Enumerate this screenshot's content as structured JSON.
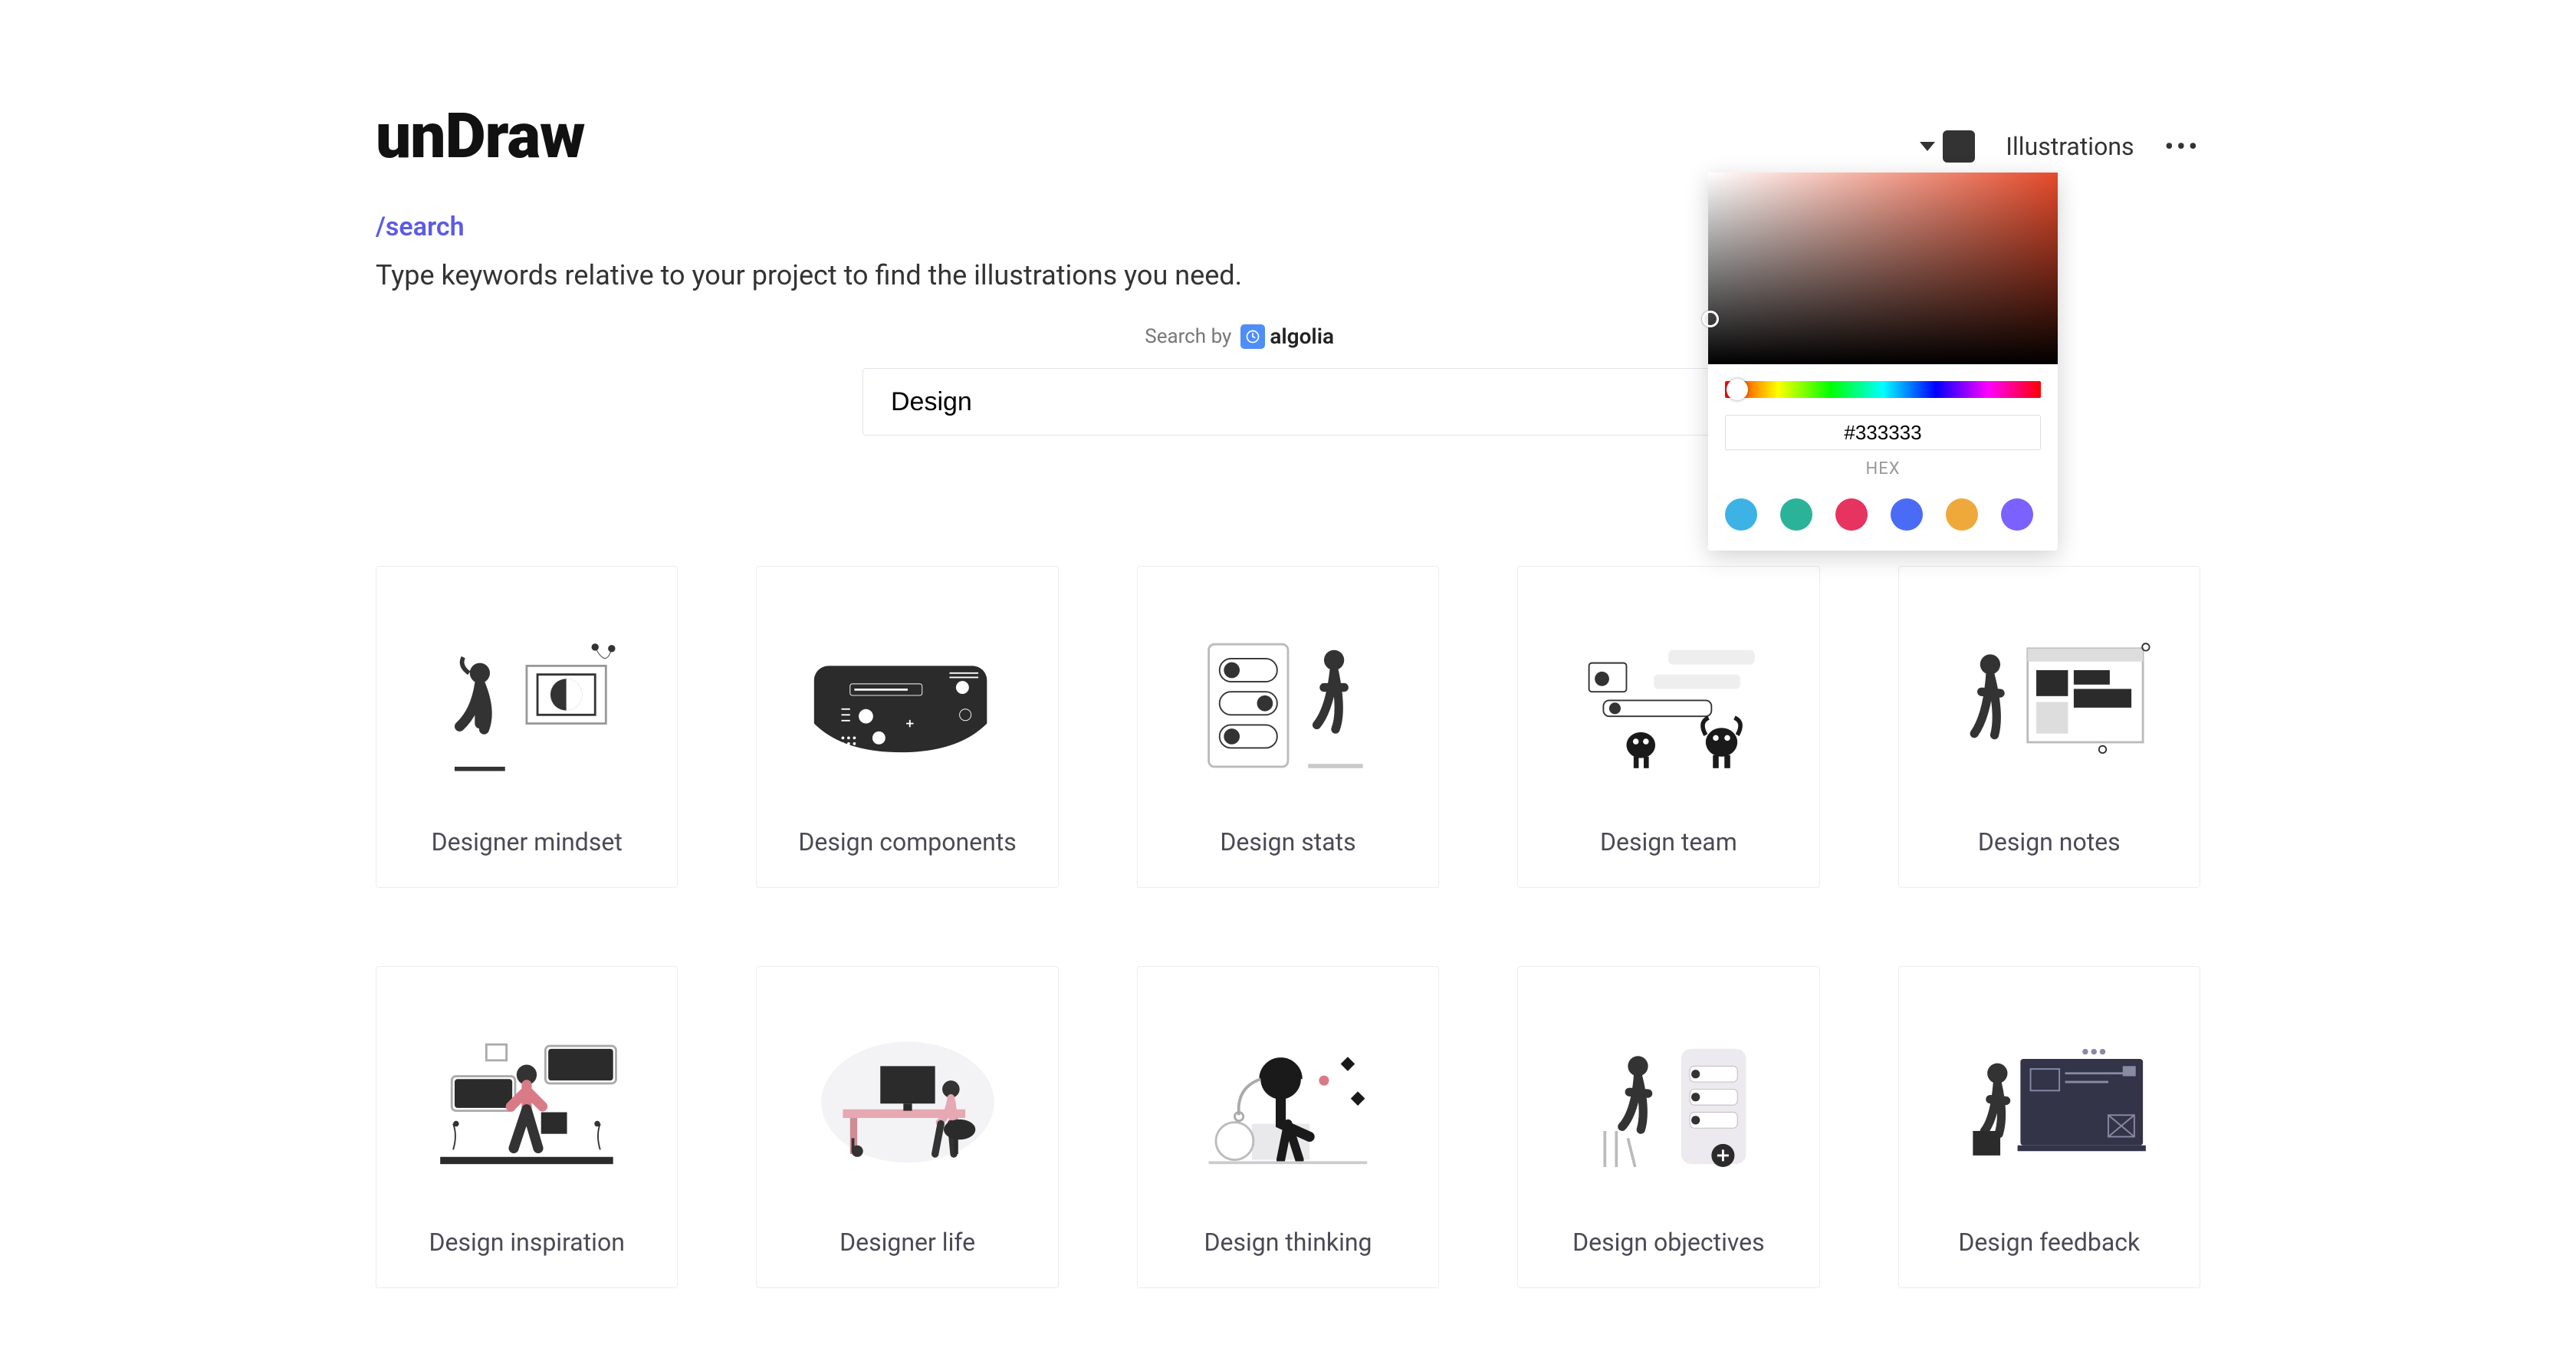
{
  "brand": "unDraw",
  "nav": {
    "link_label": "Illustrations",
    "current_color": "#333333"
  },
  "page": {
    "search_path": "/search",
    "search_desc": "Type keywords relative to your project to find the illustrations you need.",
    "attrib_prefix": "Search by",
    "attrib_name": "algolia"
  },
  "search": {
    "value": "Design",
    "placeholder": ""
  },
  "colorpicker": {
    "hex_value": "#333333",
    "hex_label": "HEX",
    "presets": [
      "#3db2e5",
      "#2bb39a",
      "#e7335f",
      "#4a6bf5",
      "#efa93a",
      "#7b61ff"
    ]
  },
  "cards": [
    {
      "title": "Designer mindset"
    },
    {
      "title": "Design components"
    },
    {
      "title": "Design stats"
    },
    {
      "title": "Design team"
    },
    {
      "title": "Design notes"
    },
    {
      "title": "Design inspiration"
    },
    {
      "title": "Designer life"
    },
    {
      "title": "Design thinking"
    },
    {
      "title": "Design objectives"
    },
    {
      "title": "Design feedback"
    }
  ]
}
